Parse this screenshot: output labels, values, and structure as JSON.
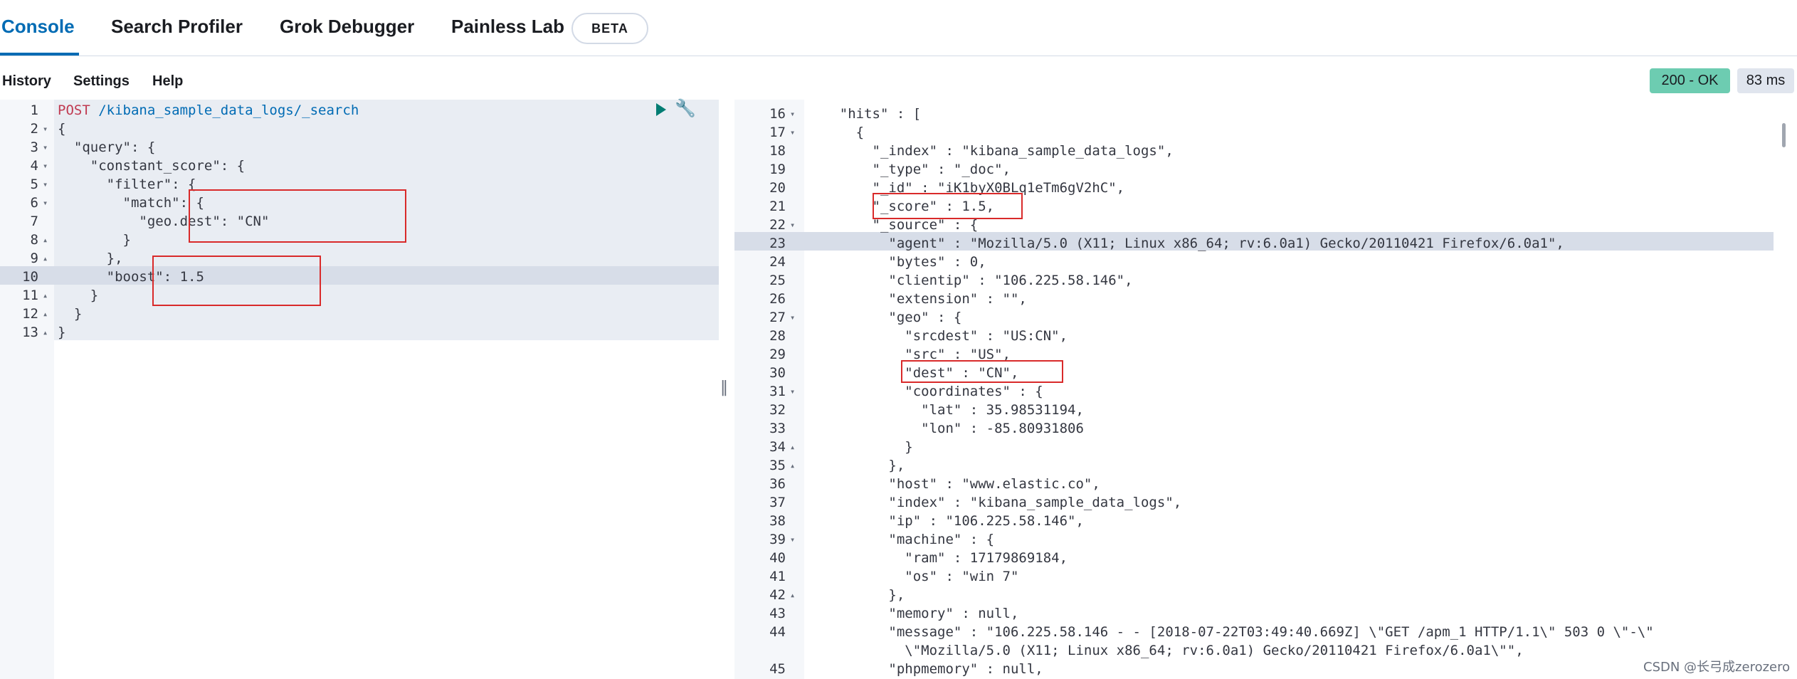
{
  "tabs": [
    {
      "label": "Console",
      "active": true
    },
    {
      "label": "Search Profiler",
      "active": false
    },
    {
      "label": "Grok Debugger",
      "active": false
    },
    {
      "label": "Painless Lab",
      "active": false
    }
  ],
  "beta_badge": "BETA",
  "menu": {
    "history": "History",
    "settings": "Settings",
    "help": "Help"
  },
  "status": {
    "code": "200 - OK",
    "time": "83 ms"
  },
  "request": {
    "lines": [
      {
        "n": "1",
        "fold": "",
        "text": ""
      },
      {
        "n": "2",
        "fold": "▾",
        "text": "{"
      },
      {
        "n": "3",
        "fold": "▾",
        "text": "  \"query\": {"
      },
      {
        "n": "4",
        "fold": "▾",
        "text": "    \"constant_score\": {"
      },
      {
        "n": "5",
        "fold": "▾",
        "text": "      \"filter\": {"
      },
      {
        "n": "6",
        "fold": "▾",
        "text": "        \"match\": {"
      },
      {
        "n": "7",
        "fold": "",
        "text": "          \"geo.dest\": \"CN\""
      },
      {
        "n": "8",
        "fold": "▴",
        "text": "        }"
      },
      {
        "n": "9",
        "fold": "▴",
        "text": "      },"
      },
      {
        "n": "10",
        "fold": "",
        "text": "      \"boost\": 1.5"
      },
      {
        "n": "11",
        "fold": "▴",
        "text": "    }"
      },
      {
        "n": "12",
        "fold": "▴",
        "text": "  }"
      },
      {
        "n": "13",
        "fold": "▴",
        "text": "}"
      }
    ],
    "method": "POST",
    "path": " /kibana_sample_data_logs/_search"
  },
  "response": {
    "lines": [
      {
        "n": "16",
        "fold": "▾",
        "text": "    \"hits\" : ["
      },
      {
        "n": "17",
        "fold": "▾",
        "text": "      {"
      },
      {
        "n": "18",
        "fold": "",
        "text": "        \"_index\" : \"kibana_sample_data_logs\","
      },
      {
        "n": "19",
        "fold": "",
        "text": "        \"_type\" : \"_doc\","
      },
      {
        "n": "20",
        "fold": "",
        "text": "        \"_id\" : \"iK1byX0BLq1eTm6gV2hC\","
      },
      {
        "n": "21",
        "fold": "",
        "text": "        \"_score\" : 1.5,"
      },
      {
        "n": "22",
        "fold": "▾",
        "text": "        \"_source\" : {"
      },
      {
        "n": "23",
        "fold": "",
        "text": "          \"agent\" : \"Mozilla/5.0 (X11; Linux x86_64; rv:6.0a1) Gecko/20110421 Firefox/6.0a1\","
      },
      {
        "n": "24",
        "fold": "",
        "text": "          \"bytes\" : 0,"
      },
      {
        "n": "25",
        "fold": "",
        "text": "          \"clientip\" : \"106.225.58.146\","
      },
      {
        "n": "26",
        "fold": "",
        "text": "          \"extension\" : \"\","
      },
      {
        "n": "27",
        "fold": "▾",
        "text": "          \"geo\" : {"
      },
      {
        "n": "28",
        "fold": "",
        "text": "            \"srcdest\" : \"US:CN\","
      },
      {
        "n": "29",
        "fold": "",
        "text": "            \"src\" : \"US\","
      },
      {
        "n": "30",
        "fold": "",
        "text": "            \"dest\" : \"CN\","
      },
      {
        "n": "31",
        "fold": "▾",
        "text": "            \"coordinates\" : {"
      },
      {
        "n": "32",
        "fold": "",
        "text": "              \"lat\" : 35.98531194,"
      },
      {
        "n": "33",
        "fold": "",
        "text": "              \"lon\" : -85.80931806"
      },
      {
        "n": "34",
        "fold": "▴",
        "text": "            }"
      },
      {
        "n": "35",
        "fold": "▴",
        "text": "          },"
      },
      {
        "n": "36",
        "fold": "",
        "text": "          \"host\" : \"www.elastic.co\","
      },
      {
        "n": "37",
        "fold": "",
        "text": "          \"index\" : \"kibana_sample_data_logs\","
      },
      {
        "n": "38",
        "fold": "",
        "text": "          \"ip\" : \"106.225.58.146\","
      },
      {
        "n": "39",
        "fold": "▾",
        "text": "          \"machine\" : {"
      },
      {
        "n": "40",
        "fold": "",
        "text": "            \"ram\" : 17179869184,"
      },
      {
        "n": "41",
        "fold": "",
        "text": "            \"os\" : \"win 7\""
      },
      {
        "n": "42",
        "fold": "▴",
        "text": "          },"
      },
      {
        "n": "43",
        "fold": "",
        "text": "          \"memory\" : null,"
      },
      {
        "n": "44",
        "fold": "",
        "text": "          \"message\" : \"106.225.58.146 - - [2018-07-22T03:49:40.669Z] \\\"GET /apm_1 HTTP/1.1\\\" 503 0 \\\"-\\\""
      },
      {
        "n": "",
        "fold": "",
        "text": "            \\\"Mozilla/5.0 (X11; Linux x86_64; rv:6.0a1) Gecko/20110421 Firefox/6.0a1\\\"\","
      },
      {
        "n": "45",
        "fold": "",
        "text": "          \"phpmemory\" : null,"
      }
    ]
  },
  "watermark": "CSDN @长弓成zerozero"
}
